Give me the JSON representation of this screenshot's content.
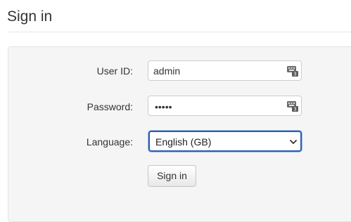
{
  "page": {
    "title": "Sign in"
  },
  "form": {
    "user_id": {
      "label": "User ID:",
      "value": "admin",
      "icon": "password-manager-key-icon"
    },
    "password": {
      "label": "Password:",
      "value": "•••••",
      "icon": "password-manager-key-icon"
    },
    "language": {
      "label": "Language:",
      "selected": "English (GB)",
      "icon": "chevron-down-icon"
    },
    "submit_label": "Sign in"
  },
  "colors": {
    "focus_border": "#2a5fb0",
    "panel_bg": "#f5f5f5"
  }
}
